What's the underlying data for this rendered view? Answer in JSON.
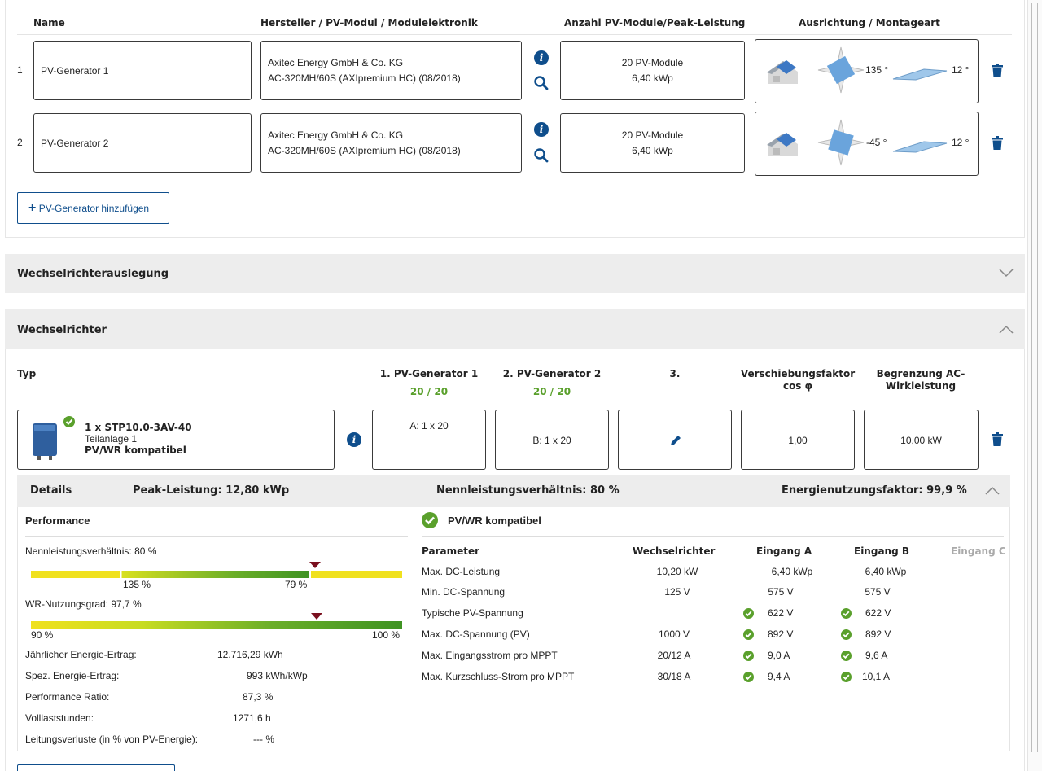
{
  "pv_generators": {
    "headers": {
      "name": "Name",
      "hersteller": "Hersteller / PV-Modul / Modulelektronik",
      "anzahl": "Anzahl PV-Module/Peak-Leistung",
      "ausrichtung": "Ausrichtung / Montageart"
    },
    "rows": [
      {
        "index": "1",
        "name": "PV-Generator 1",
        "manufacturer": "Axitec Energy GmbH & Co. KG",
        "module": "AC-320MH/60S (AXIpremium HC) (08/2018)",
        "modules": "20 PV-Module",
        "peak": "6,40 kWp",
        "azimuth": "135 °",
        "tilt": "12 °"
      },
      {
        "index": "2",
        "name": "PV-Generator 2",
        "manufacturer": "Axitec Energy GmbH & Co. KG",
        "module": "AC-320MH/60S (AXIpremium HC) (08/2018)",
        "modules": "20 PV-Module",
        "peak": "6,40 kWp",
        "azimuth": "-45 °",
        "tilt": "12 °"
      }
    ],
    "add_button": "PV-Generator hinzufügen"
  },
  "sections": {
    "wechselrichterauslegung": "Wechselrichterauslegung",
    "wechselrichter": "Wechselrichter"
  },
  "inverter": {
    "headers": {
      "typ": "Typ",
      "gen1": "1. PV-Generator 1",
      "gen1_count": "20 / 20",
      "gen2": "2. PV-Generator 2",
      "gen2_count": "20 / 20",
      "gen3": "3.",
      "cos_line1": "Verschiebungsfaktor",
      "cos_line2": "cos φ",
      "ac_line1": "Begrenzung AC-",
      "ac_line2": "Wirkleistung"
    },
    "name": "1 x STP10.0-3AV-40",
    "subsystem": "Teilanlage 1",
    "compat": "PV/WR kompatibel",
    "input_a": "A: 1 x 20",
    "input_b": "B: 1 x 20",
    "cos_phi": "1,00",
    "ac_limit": "10,00 kW"
  },
  "details": {
    "label": "Details",
    "peak": "Peak-Leistung: 12,80 kWp",
    "ratio": "Nennleistungsverhältnis: 80 %",
    "efficiency": "Energienutzungsfaktor: 99,9 %"
  },
  "performance": {
    "title": "Performance",
    "bar1_label": "Nennleistungsverhältnis: 80 %",
    "bar1_min": "135 %",
    "bar1_max": "79 %",
    "bar1_marker_fraction": 0.765,
    "bar2_label": "WR-Nutzungsgrad: 97,7 %",
    "bar2_min": "90 %",
    "bar2_max": "100 %",
    "bar2_marker_fraction": 0.77,
    "stats": [
      {
        "label": "Jährlicher Energie-Ertrag:",
        "value": "12.716,29 kWh"
      },
      {
        "label": "Spez. Energie-Ertrag:",
        "value": "993 kWh/kWp"
      },
      {
        "label": "Performance Ratio:",
        "value": "87,3 %"
      },
      {
        "label": "Volllaststunden:",
        "value": "1271,6 h"
      },
      {
        "label": "Leitungsverluste (in % von PV-Energie):",
        "value": "--- %"
      }
    ]
  },
  "compat_table": {
    "title": "PV/WR kompatibel",
    "headers": [
      "Parameter",
      "Wechselrichter",
      "Eingang A",
      "Eingang B",
      "Eingang C"
    ],
    "rows": [
      {
        "param": "Max. DC-Leistung",
        "wr": "10,20 kW",
        "a": "6,40 kWp",
        "b": "6,40 kWp",
        "check": false
      },
      {
        "param": "Min. DC-Spannung",
        "wr": "125 V",
        "a": "575 V",
        "b": "575 V",
        "check": false
      },
      {
        "param": "Typische PV-Spannung",
        "wr": "",
        "a": "622 V",
        "b": "622 V",
        "check": true
      },
      {
        "param": "Max. DC-Spannung (PV)",
        "wr": "1000 V",
        "a": "892 V",
        "b": "892 V",
        "check": true
      },
      {
        "param": "Max. Eingangsstrom pro MPPT",
        "wr": "20/12 A",
        "a": "9,0 A",
        "b": "9,6 A",
        "check": true
      },
      {
        "param": "Max. Kurzschluss-Strom pro MPPT",
        "wr": "30/18 A",
        "a": "9,4 A",
        "b": "10,1 A",
        "check": true
      }
    ]
  },
  "colors": {
    "accent": "#0f4e8c",
    "green": "#5aa02c",
    "panel": "#ededed",
    "marker": "#7a0f1e"
  }
}
